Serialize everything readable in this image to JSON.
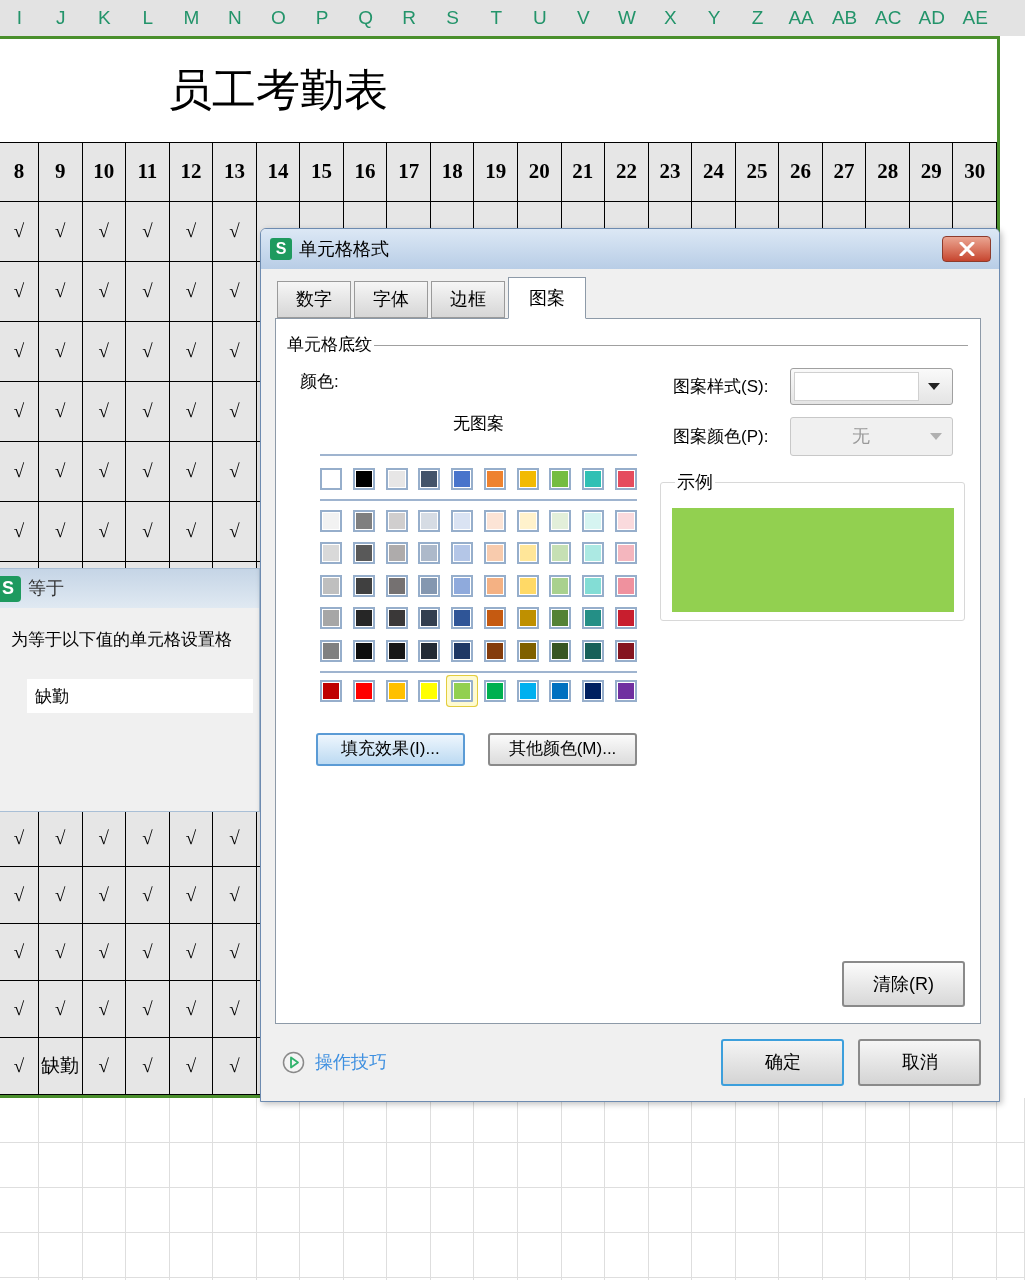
{
  "column_headers": [
    "I",
    "J",
    "K",
    "L",
    "M",
    "N",
    "O",
    "P",
    "Q",
    "R",
    "S",
    "T",
    "U",
    "V",
    "W",
    "X",
    "Y",
    "Z",
    "AA",
    "AB",
    "AC",
    "AD",
    "AE"
  ],
  "title": "员工考勤表",
  "day_numbers": [
    "8",
    "9",
    "10",
    "11",
    "12",
    "13",
    "14",
    "15",
    "16",
    "17",
    "18",
    "19",
    "20",
    "21",
    "22",
    "23",
    "24",
    "25",
    "26",
    "27",
    "28",
    "29",
    "30"
  ],
  "attendance_top": [
    [
      "√",
      "√",
      "√",
      "√",
      "√",
      "√"
    ],
    [
      "√",
      "√",
      "√",
      "√",
      "√",
      "√"
    ],
    [
      "√",
      "√",
      "√",
      "√",
      "√",
      "√"
    ],
    [
      "√",
      "√",
      "√",
      "√",
      "√",
      "√"
    ],
    [
      "√",
      "√",
      "√",
      "√",
      "√",
      "√"
    ],
    [
      "√",
      "√",
      "√",
      "√",
      "√",
      "√"
    ]
  ],
  "attendance_bottom": [
    [
      "√",
      "√",
      "√",
      "√",
      "√",
      "√"
    ],
    [
      "√",
      "√",
      "√",
      "√",
      "√",
      "√"
    ],
    [
      "√",
      "√",
      "√",
      "√",
      "√",
      "√"
    ],
    [
      "√",
      "√",
      "√",
      "√",
      "√",
      "√"
    ],
    [
      "√",
      "缺勤",
      "√",
      "√",
      "√",
      "√"
    ]
  ],
  "rule_dialog": {
    "icon_letter": "S",
    "title": "等于",
    "prompt": "为等于以下值的单元格设置格",
    "value": "缺勤"
  },
  "format_dialog": {
    "icon_letter": "S",
    "title": "单元格格式",
    "tabs": [
      {
        "label": "数字",
        "selected": false
      },
      {
        "label": "字体",
        "selected": false
      },
      {
        "label": "边框",
        "selected": false
      },
      {
        "label": "图案",
        "selected": true
      }
    ],
    "section": "单元格底纹",
    "color_label": "颜色:",
    "no_pattern": "无图案",
    "theme_colors": [
      {
        "color": "#ffffff",
        "selected": false
      },
      {
        "color": "#000000",
        "selected": false
      },
      {
        "color": "#e7e6e6",
        "selected": false
      },
      {
        "color": "#44546a",
        "selected": false
      },
      {
        "color": "#4874cb",
        "selected": false
      },
      {
        "color": "#ee822f",
        "selected": false
      },
      {
        "color": "#f2ba02",
        "selected": false
      },
      {
        "color": "#75bd42",
        "selected": false
      },
      {
        "color": "#30c0b4",
        "selected": false
      },
      {
        "color": "#e54c5e",
        "selected": false
      }
    ],
    "shades": [
      [
        {
          "color": "#f2f2f2",
          "selected": false
        },
        {
          "color": "#7f7f7f",
          "selected": false
        },
        {
          "color": "#d0cece",
          "selected": false
        },
        {
          "color": "#d6dce4",
          "selected": false
        },
        {
          "color": "#dae3f3",
          "selected": false
        },
        {
          "color": "#fce4d6",
          "selected": false
        },
        {
          "color": "#fff2cc",
          "selected": false
        },
        {
          "color": "#e2efda",
          "selected": false
        },
        {
          "color": "#d6f4f1",
          "selected": false
        },
        {
          "color": "#fadadd",
          "selected": false
        }
      ],
      [
        {
          "color": "#d9d9d9",
          "selected": false
        },
        {
          "color": "#595959",
          "selected": false
        },
        {
          "color": "#aeabab",
          "selected": false
        },
        {
          "color": "#adb9ca",
          "selected": false
        },
        {
          "color": "#b4c6e7",
          "selected": false
        },
        {
          "color": "#f8cbad",
          "selected": false
        },
        {
          "color": "#ffe699",
          "selected": false
        },
        {
          "color": "#c6e0b4",
          "selected": false
        },
        {
          "color": "#ace9e3",
          "selected": false
        },
        {
          "color": "#f4b6be",
          "selected": false
        }
      ],
      [
        {
          "color": "#bfbfbf",
          "selected": false
        },
        {
          "color": "#404040",
          "selected": false
        },
        {
          "color": "#757171",
          "selected": false
        },
        {
          "color": "#8497b0",
          "selected": false
        },
        {
          "color": "#8faadc",
          "selected": false
        },
        {
          "color": "#f4b183",
          "selected": false
        },
        {
          "color": "#ffd966",
          "selected": false
        },
        {
          "color": "#a9d18e",
          "selected": false
        },
        {
          "color": "#83ddd5",
          "selected": false
        },
        {
          "color": "#ef919e",
          "selected": false
        }
      ],
      [
        {
          "color": "#a6a6a6",
          "selected": false
        },
        {
          "color": "#262626",
          "selected": false
        },
        {
          "color": "#3a3838",
          "selected": false
        },
        {
          "color": "#333f50",
          "selected": false
        },
        {
          "color": "#2f5597",
          "selected": false
        },
        {
          "color": "#c55a11",
          "selected": false
        },
        {
          "color": "#bf9000",
          "selected": false
        },
        {
          "color": "#548235",
          "selected": false
        },
        {
          "color": "#248f86",
          "selected": false
        },
        {
          "color": "#c81e2e",
          "selected": false
        }
      ],
      [
        {
          "color": "#808080",
          "selected": false
        },
        {
          "color": "#0d0d0d",
          "selected": false
        },
        {
          "color": "#171717",
          "selected": false
        },
        {
          "color": "#222a35",
          "selected": false
        },
        {
          "color": "#1f3864",
          "selected": false
        },
        {
          "color": "#843c0c",
          "selected": false
        },
        {
          "color": "#7f6000",
          "selected": false
        },
        {
          "color": "#375623",
          "selected": false
        },
        {
          "color": "#186059",
          "selected": false
        },
        {
          "color": "#851520",
          "selected": false
        }
      ]
    ],
    "standard_colors": [
      {
        "color": "#c00000",
        "selected": false
      },
      {
        "color": "#ff0000",
        "selected": false
      },
      {
        "color": "#ffc000",
        "selected": false
      },
      {
        "color": "#ffff00",
        "selected": false
      },
      {
        "color": "#92d050",
        "selected": true
      },
      {
        "color": "#00b050",
        "selected": false
      },
      {
        "color": "#00b0f0",
        "selected": false
      },
      {
        "color": "#0070c0",
        "selected": false
      },
      {
        "color": "#002060",
        "selected": false
      },
      {
        "color": "#7030a0",
        "selected": false
      }
    ],
    "fill_effects_button": "填充效果(I)...",
    "more_colors_button": "其他颜色(M)...",
    "pattern_style_label": "图案样式(S):",
    "pattern_color_label": "图案颜色(P):",
    "pattern_color_value": "无",
    "pattern_color_disabled": true,
    "sample_label": "示例",
    "clear_button": "清除(R)",
    "tips_link": "操作技巧",
    "ok_button": "确定",
    "cancel_button": "取消"
  }
}
